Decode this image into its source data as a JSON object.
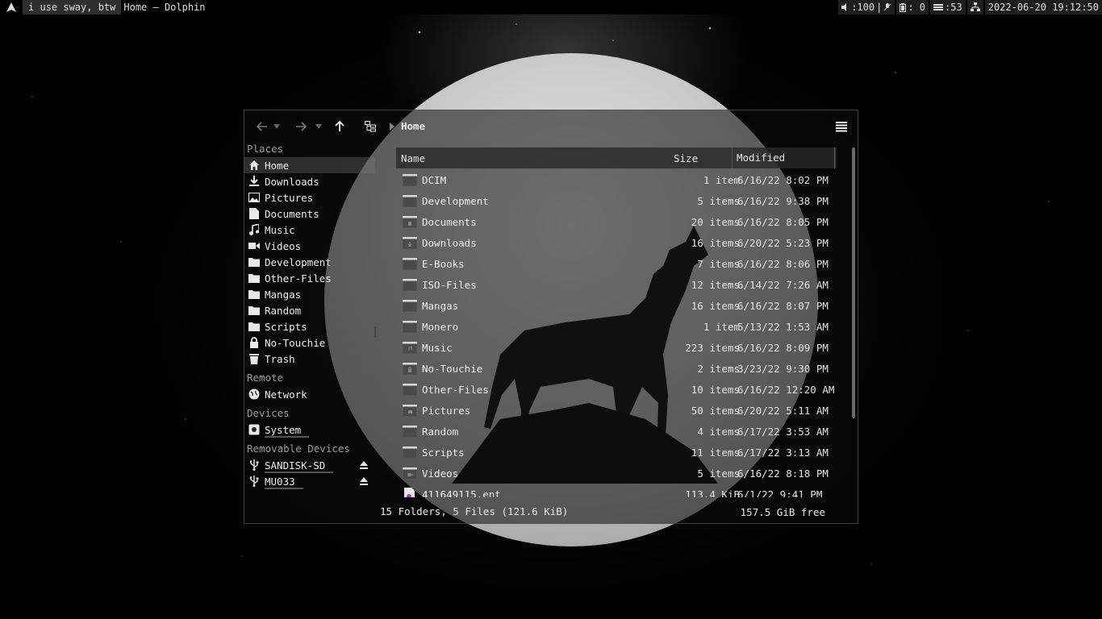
{
  "topbar": {
    "launcher_icon": "arch-logo-icon",
    "workspace": "i use sway, btw",
    "window_title": "Home — Dolphin",
    "volume": ":100",
    "mic": "",
    "battery": ": 0",
    "memory": ":53",
    "network": "",
    "datetime": "2022-06-20 19:12:50"
  },
  "toolbar": {
    "breadcrumb": "Home"
  },
  "places": {
    "places_title": "Places",
    "items": [
      {
        "label": "Home",
        "icon": "home-icon"
      },
      {
        "label": "Downloads",
        "icon": "download-icon"
      },
      {
        "label": "Pictures",
        "icon": "image-icon"
      },
      {
        "label": "Documents",
        "icon": "document-icon"
      },
      {
        "label": "Music",
        "icon": "music-icon"
      },
      {
        "label": "Videos",
        "icon": "video-icon"
      },
      {
        "label": "Development",
        "icon": "folder-icon"
      },
      {
        "label": "Other-Files",
        "icon": "folder-icon"
      },
      {
        "label": "Mangas",
        "icon": "folder-icon"
      },
      {
        "label": "Random",
        "icon": "folder-icon"
      },
      {
        "label": "Scripts",
        "icon": "folder-icon"
      },
      {
        "label": "No-Touchie",
        "icon": "lock-icon"
      },
      {
        "label": "Trash",
        "icon": "trash-icon"
      }
    ],
    "remote_title": "Remote",
    "remote": [
      {
        "label": "Network",
        "icon": "globe-icon"
      }
    ],
    "devices_title": "Devices",
    "devices": [
      {
        "label": "System",
        "icon": "disk-icon"
      }
    ],
    "removable_title": "Removable Devices",
    "removable": [
      {
        "label": "SANDISK-SD",
        "icon": "usb-icon"
      },
      {
        "label": "MU033",
        "icon": "usb-icon"
      }
    ]
  },
  "columns": {
    "name": "Name",
    "size": "Size",
    "modified": "Modified"
  },
  "files": [
    {
      "name": "DCIM",
      "size": "1 item",
      "modified": "6/16/22 8:02 PM",
      "icon": "folder-icon"
    },
    {
      "name": "Development",
      "size": "5 items",
      "modified": "6/16/22 9:38 PM",
      "icon": "folder-icon"
    },
    {
      "name": "Documents",
      "size": "20 items",
      "modified": "6/16/22 8:05 PM",
      "icon": "folder-documents-icon"
    },
    {
      "name": "Downloads",
      "size": "16 items",
      "modified": "6/20/22 5:23 PM",
      "icon": "folder-download-icon"
    },
    {
      "name": "E-Books",
      "size": "7 items",
      "modified": "6/16/22 8:06 PM",
      "icon": "folder-icon"
    },
    {
      "name": "ISO-Files",
      "size": "12 items",
      "modified": "6/14/22 7:26 AM",
      "icon": "folder-icon"
    },
    {
      "name": "Mangas",
      "size": "16 items",
      "modified": "6/16/22 8:07 PM",
      "icon": "folder-icon"
    },
    {
      "name": "Monero",
      "size": "1 item",
      "modified": "5/13/22 1:53 AM",
      "icon": "folder-icon"
    },
    {
      "name": "Music",
      "size": "223 items",
      "modified": "6/16/22 8:09 PM",
      "icon": "folder-music-icon"
    },
    {
      "name": "No-Touchie",
      "size": "2 items",
      "modified": "3/23/22 9:30 PM",
      "icon": "folder-locked-icon"
    },
    {
      "name": "Other-Files",
      "size": "10 items",
      "modified": "6/16/22 12:20 AM",
      "icon": "folder-icon"
    },
    {
      "name": "Pictures",
      "size": "50 items",
      "modified": "6/20/22 5:11 AM",
      "icon": "folder-pictures-icon"
    },
    {
      "name": "Random",
      "size": "4 items",
      "modified": "6/17/22 3:53 AM",
      "icon": "folder-icon"
    },
    {
      "name": "Scripts",
      "size": "11 items",
      "modified": "6/17/22 3:13 AM",
      "icon": "folder-icon"
    },
    {
      "name": "Videos",
      "size": "5 items",
      "modified": "6/16/22 8:18 PM",
      "icon": "folder-videos-icon"
    },
    {
      "name": "411649115.ent",
      "size": "113.4 KiB",
      "modified": "6/1/22 9:41 PM",
      "icon": "file-icon"
    }
  ],
  "status": {
    "summary": "15 Folders, 5 Files (121.6 KiB)",
    "free": "157.5 GiB free"
  }
}
